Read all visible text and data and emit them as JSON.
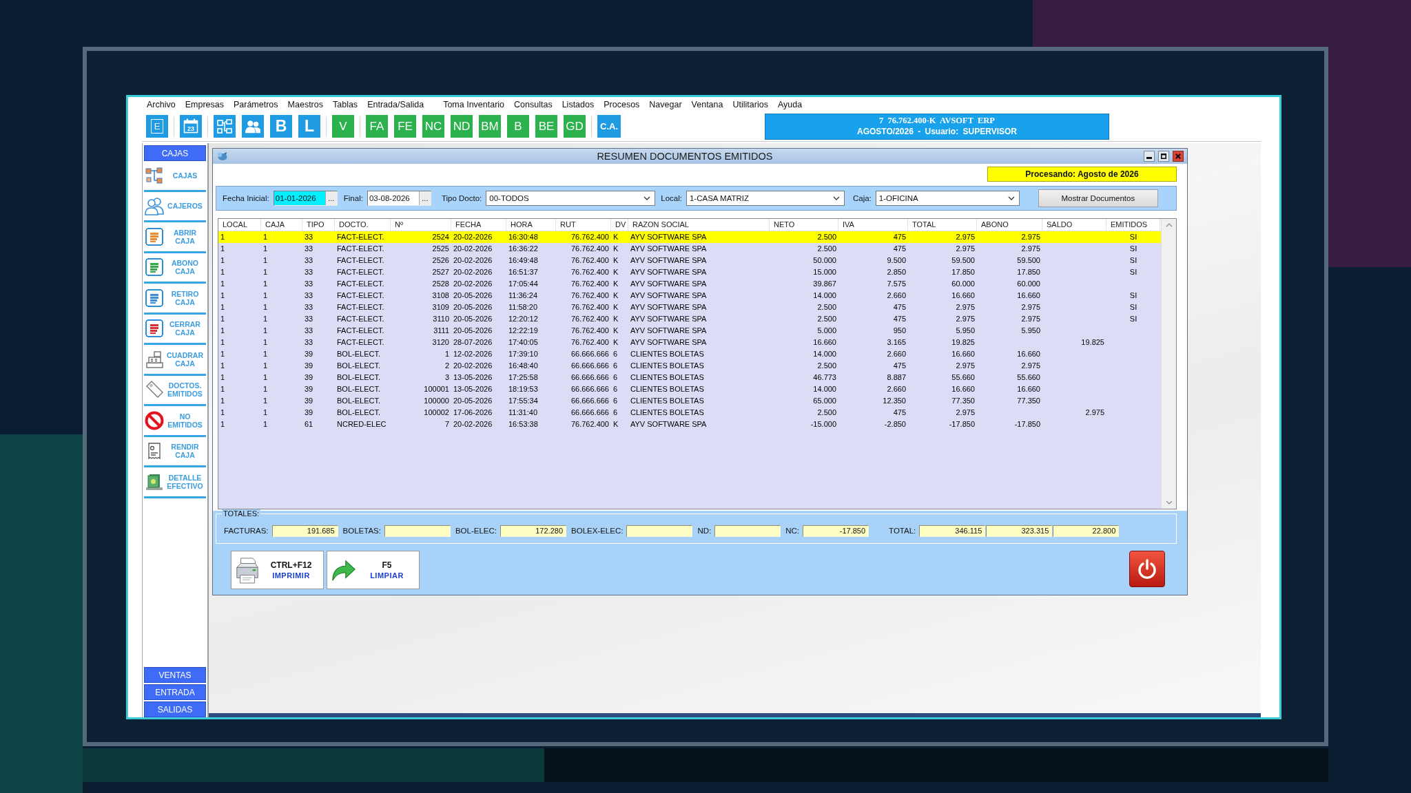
{
  "menu": [
    "Archivo",
    "Empresas",
    "Parámetros",
    "Maestros",
    "Tablas",
    "Entrada/Salida",
    "Toma Inventario",
    "Consultas",
    "Listados",
    "Procesos",
    "Navegar",
    "Ventana",
    "Utilitarios",
    "Ayuda"
  ],
  "toolbar": {
    "groups": [
      {
        "buttons": [
          {
            "kind": "boxed",
            "label": "E",
            "color": "#1e9be3"
          }
        ]
      },
      {
        "buttons": [
          {
            "kind": "calendar",
            "label": "23",
            "color": "#1e9be3"
          }
        ]
      },
      {
        "buttons": [
          {
            "kind": "hierarchy",
            "color": "#1e9be3"
          },
          {
            "kind": "people",
            "color": "#1e9be3"
          },
          {
            "kind": "large",
            "label": "B",
            "color": "#1e9be3"
          },
          {
            "kind": "large",
            "label": "L",
            "color": "#1e9be3"
          }
        ]
      },
      {
        "buttons": [
          {
            "kind": "letter",
            "label": "V",
            "color": "#2bb24c"
          }
        ]
      },
      {
        "buttons": [
          {
            "kind": "letter",
            "label": "FA",
            "color": "#2bb24c"
          },
          {
            "kind": "letter",
            "label": "FE",
            "color": "#2bb24c"
          },
          {
            "kind": "letter",
            "label": "NC",
            "color": "#2bb24c"
          },
          {
            "kind": "letter",
            "label": "ND",
            "color": "#2bb24c"
          },
          {
            "kind": "letter",
            "label": "BM",
            "color": "#2bb24c"
          },
          {
            "kind": "letter",
            "label": "B",
            "color": "#2bb24c"
          },
          {
            "kind": "letter",
            "label": "BE",
            "color": "#2bb24c"
          },
          {
            "kind": "letter",
            "label": "GD",
            "color": "#2bb24c"
          }
        ]
      },
      {
        "buttons": [
          {
            "kind": "small",
            "label": "C.A.",
            "color": "#1e9be3"
          }
        ]
      }
    ]
  },
  "info_panel": {
    "lines": [
      "7 76.762.400-K AVSOFT ERP",
      "AGOSTO/2026 - Usuario: SUPERVISOR"
    ]
  },
  "sidebar": {
    "header": "CAJAS",
    "items": [
      {
        "kind": "hierarchy",
        "label": "CAJAS"
      },
      {
        "kind": "people",
        "label": "CAJEROS"
      },
      {
        "kind": "document",
        "label": "ABRIR CAJA",
        "color": "#f08a30"
      },
      {
        "kind": "document",
        "label": "ABONO CAJA",
        "color": "#35a84a"
      },
      {
        "kind": "document",
        "label": "RETIRO CAJA",
        "color": "#3a8ee0"
      },
      {
        "kind": "document",
        "label": "CERRAR CAJA",
        "color": "#d8303a"
      },
      {
        "kind": "register",
        "label": "CUADRAR CAJA"
      },
      {
        "kind": "tag",
        "label": "DOCTOS. EMITIDOS"
      },
      {
        "kind": "prohibited",
        "label": "NO EMITIDOS"
      },
      {
        "kind": "receipt",
        "label": "RENDIR CAJA"
      },
      {
        "kind": "cash",
        "label": "DETALLE EFECTIVO"
      }
    ],
    "sections": [
      "VENTAS",
      "ENTRADA",
      "SALIDAS"
    ]
  },
  "window": {
    "title": "RESUMEN DOCUMENTOS EMITIDOS",
    "status": "Procesando: Agosto de 2026",
    "filters": [
      {
        "kind": "date",
        "label": "Fecha Inicial:",
        "value": "01-01-2026",
        "button": "...",
        "focused": true
      },
      {
        "kind": "date",
        "label": "Final:",
        "value": "03-08-2026",
        "button": "...",
        "focused": false
      },
      {
        "kind": "select",
        "label": "Tipo Docto:",
        "value": "00-TODOS",
        "focused": false
      },
      {
        "kind": "select",
        "label": "Local:",
        "value": "1-CASA MATRIZ",
        "focused": false
      },
      {
        "kind": "select",
        "label": "Caja:",
        "value": "1-OFICINA",
        "focused": false
      }
    ],
    "show_button": "Mostrar Documentos"
  },
  "table": {
    "columns": [
      "LOCAL",
      "CAJA",
      "TIPO",
      "DOCTO.",
      "Nº",
      "FECHA",
      "HORA",
      "RUT",
      "DV",
      "RAZON SOCIAL",
      "NETO",
      "IVA",
      "TOTAL",
      "ABONO",
      "SALDO",
      "EMITIDOS"
    ],
    "rows": [
      {
        "selected": true,
        "local": "1",
        "caja": "1",
        "tipo": "33",
        "docto": "FACT-ELECT.",
        "numero": "2524",
        "fecha": "20-02-2026",
        "hora": "16:30:48",
        "rut": "76.762.400",
        "dv": "K",
        "razon_social": "AYV SOFTWARE SPA",
        "neto": "2.500",
        "iva": "475",
        "total": "2.975",
        "abono": "2.975",
        "emitidos": "SI"
      },
      {
        "selected": false,
        "local": "1",
        "caja": "1",
        "tipo": "33",
        "docto": "FACT-ELECT.",
        "numero": "2525",
        "fecha": "20-02-2026",
        "hora": "16:36:22",
        "rut": "76.762.400",
        "dv": "K",
        "razon_social": "AYV SOFTWARE SPA",
        "neto": "2.500",
        "iva": "475",
        "total": "2.975",
        "abono": "2.975",
        "emitidos": "SI"
      },
      {
        "selected": false,
        "local": "1",
        "caja": "1",
        "tipo": "33",
        "docto": "FACT-ELECT.",
        "numero": "2526",
        "fecha": "20-02-2026",
        "hora": "16:49:48",
        "rut": "76.762.400",
        "dv": "K",
        "razon_social": "AYV SOFTWARE SPA",
        "neto": "50.000",
        "iva": "9.500",
        "total": "59.500",
        "abono": "59.500",
        "emitidos": "SI"
      },
      {
        "selected": false,
        "local": "1",
        "caja": "1",
        "tipo": "33",
        "docto": "FACT-ELECT.",
        "numero": "2527",
        "fecha": "20-02-2026",
        "hora": "16:51:37",
        "rut": "76.762.400",
        "dv": "K",
        "razon_social": "AYV SOFTWARE SPA",
        "neto": "15.000",
        "iva": "2.850",
        "total": "17.850",
        "abono": "17.850",
        "emitidos": "SI"
      },
      {
        "selected": false,
        "local": "1",
        "caja": "1",
        "tipo": "33",
        "docto": "FACT-ELECT.",
        "numero": "2528",
        "fecha": "20-02-2026",
        "hora": "17:05:44",
        "rut": "76.762.400",
        "dv": "K",
        "razon_social": "AYV SOFTWARE SPA",
        "neto": "39.867",
        "iva": "7.575",
        "total": "60.000",
        "abono": "60.000"
      },
      {
        "selected": false,
        "local": "1",
        "caja": "1",
        "tipo": "33",
        "docto": "FACT-ELECT.",
        "numero": "3108",
        "fecha": "20-05-2026",
        "hora": "11:36:24",
        "rut": "76.762.400",
        "dv": "K",
        "razon_social": "AYV SOFTWARE SPA",
        "neto": "14.000",
        "iva": "2.660",
        "total": "16.660",
        "abono": "16.660",
        "emitidos": "SI"
      },
      {
        "selected": false,
        "local": "1",
        "caja": "1",
        "tipo": "33",
        "docto": "FACT-ELECT.",
        "numero": "3109",
        "fecha": "20-05-2026",
        "hora": "11:58:20",
        "rut": "76.762.400",
        "dv": "K",
        "razon_social": "AYV SOFTWARE SPA",
        "neto": "2.500",
        "iva": "475",
        "total": "2.975",
        "abono": "2.975",
        "emitidos": "SI"
      },
      {
        "selected": false,
        "local": "1",
        "caja": "1",
        "tipo": "33",
        "docto": "FACT-ELECT.",
        "numero": "3110",
        "fecha": "20-05-2026",
        "hora": "12:20:12",
        "rut": "76.762.400",
        "dv": "K",
        "razon_social": "AYV SOFTWARE SPA",
        "neto": "2.500",
        "iva": "475",
        "total": "2.975",
        "abono": "2.975",
        "emitidos": "SI"
      },
      {
        "selected": false,
        "local": "1",
        "caja": "1",
        "tipo": "33",
        "docto": "FACT-ELECT.",
        "numero": "3111",
        "fecha": "20-05-2026",
        "hora": "12:22:19",
        "rut": "76.762.400",
        "dv": "K",
        "razon_social": "AYV SOFTWARE SPA",
        "neto": "5.000",
        "iva": "950",
        "total": "5.950",
        "abono": "5.950"
      },
      {
        "selected": false,
        "local": "1",
        "caja": "1",
        "tipo": "33",
        "docto": "FACT-ELECT.",
        "numero": "3120",
        "fecha": "28-07-2026",
        "hora": "17:40:05",
        "rut": "76.762.400",
        "dv": "K",
        "razon_social": "AYV SOFTWARE SPA",
        "neto": "16.660",
        "iva": "3.165",
        "total": "19.825",
        "saldo": "19.825"
      },
      {
        "selected": false,
        "local": "1",
        "caja": "1",
        "tipo": "39",
        "docto": "BOL-ELECT.",
        "numero": "1",
        "fecha": "12-02-2026",
        "hora": "17:39:10",
        "rut": "66.666.666",
        "dv": "6",
        "razon_social": "CLIENTES BOLETAS",
        "neto": "14.000",
        "iva": "2.660",
        "total": "16.660",
        "abono": "16.660"
      },
      {
        "selected": false,
        "local": "1",
        "caja": "1",
        "tipo": "39",
        "docto": "BOL-ELECT.",
        "numero": "2",
        "fecha": "20-02-2026",
        "hora": "16:48:40",
        "rut": "66.666.666",
        "dv": "6",
        "razon_social": "CLIENTES BOLETAS",
        "neto": "2.500",
        "iva": "475",
        "total": "2.975",
        "abono": "2.975"
      },
      {
        "selected": false,
        "local": "1",
        "caja": "1",
        "tipo": "39",
        "docto": "BOL-ELECT.",
        "numero": "3",
        "fecha": "13-05-2026",
        "hora": "17:25:58",
        "rut": "66.666.666",
        "dv": "6",
        "razon_social": "CLIENTES BOLETAS",
        "neto": "46.773",
        "iva": "8.887",
        "total": "55.660",
        "abono": "55.660"
      },
      {
        "selected": false,
        "local": "1",
        "caja": "1",
        "tipo": "39",
        "docto": "BOL-ELECT.",
        "numero": "100001",
        "fecha": "13-05-2026",
        "hora": "18:19:53",
        "rut": "66.666.666",
        "dv": "6",
        "razon_social": "CLIENTES BOLETAS",
        "neto": "14.000",
        "iva": "2.660",
        "total": "16.660",
        "abono": "16.660"
      },
      {
        "selected": false,
        "local": "1",
        "caja": "1",
        "tipo": "39",
        "docto": "BOL-ELECT.",
        "numero": "100000",
        "fecha": "20-05-2026",
        "hora": "17:55:34",
        "rut": "66.666.666",
        "dv": "6",
        "razon_social": "CLIENTES BOLETAS",
        "neto": "65.000",
        "iva": "12.350",
        "total": "77.350",
        "abono": "77.350"
      },
      {
        "selected": false,
        "local": "1",
        "caja": "1",
        "tipo": "39",
        "docto": "BOL-ELECT.",
        "numero": "100002",
        "fecha": "17-06-2026",
        "hora": "11:31:40",
        "rut": "66.666.666",
        "dv": "6",
        "razon_social": "CLIENTES BOLETAS",
        "neto": "2.500",
        "iva": "475",
        "total": "2.975",
        "saldo": "2.975"
      },
      {
        "selected": false,
        "local": "1",
        "caja": "1",
        "tipo": "61",
        "docto": "NCRED-ELEC",
        "numero": "7",
        "fecha": "20-02-2026",
        "hora": "16:53:38",
        "rut": "76.762.400",
        "dv": "K",
        "razon_social": "AYV SOFTWARE SPA",
        "neto": "-15.000",
        "iva": "-2.850",
        "total": "-17.850",
        "abono": "-17.850"
      }
    ]
  },
  "totals": {
    "title": "TOTALES:",
    "fields": [
      {
        "label": "FACTURAS:",
        "value": "191.685"
      },
      {
        "label": "BOLETAS:"
      },
      {
        "label": "BOL-ELEC:",
        "value": "172.280"
      },
      {
        "label": "BOLEX-ELEC:"
      },
      {
        "label": "ND:"
      },
      {
        "label": "NC:",
        "value": "-17.850"
      },
      {
        "label": "TOTAL:",
        "values": [
          "346.115",
          "323.315",
          "22.800"
        ]
      }
    ]
  },
  "actions": [
    {
      "kind": "print",
      "shortcut": "CTRL+F12",
      "label": "IMPRIMIR"
    },
    {
      "kind": "clear",
      "shortcut": "F5",
      "label": "LIMPIAR"
    }
  ]
}
